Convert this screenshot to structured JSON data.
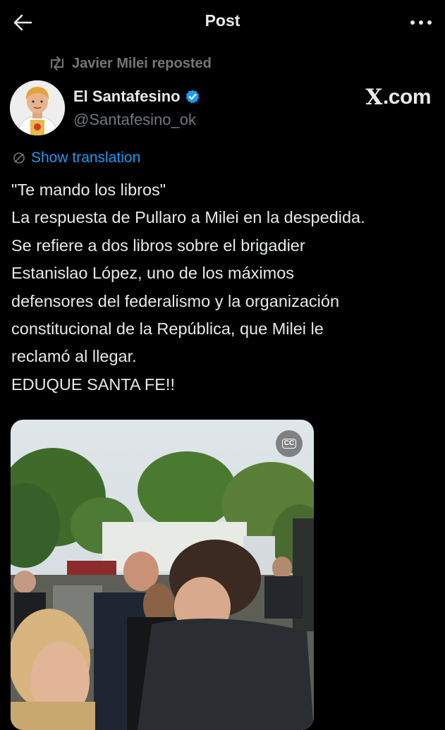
{
  "header": {
    "title": "Post",
    "back_icon": "arrow-left-icon",
    "more_icon": "more-horizontal-icon"
  },
  "repost": {
    "text": "Javier Milei reposted",
    "icon": "repost-icon"
  },
  "author": {
    "name": "El Santafesino",
    "handle": "@Santafesino_ok",
    "verified_color": "#1d9bf0",
    "source_logo": "X.com",
    "source_logo_x": "X",
    "source_logo_rest": ".com"
  },
  "translate": {
    "label": "Show translation",
    "icon": "globe-icon"
  },
  "post": {
    "text": "\"Te mando los libros\"\nLa respuesta de Pullaro a Milei en la despedida.\nSe refiere a dos libros sobre el brigadier\nEstanislao López, uno de los máximos\ndefensores del federalismo y la organización\nconstitucional de la República, que Milei le\nreclamó al llegar.\nEDUQUE SANTA FE!!"
  },
  "media": {
    "cc_label": "CC",
    "cc_icon": "closed-captions-icon"
  },
  "colors": {
    "background": "#000000",
    "text": "#e7e9ea",
    "muted": "#71767b",
    "accent": "#1d9bf0"
  }
}
